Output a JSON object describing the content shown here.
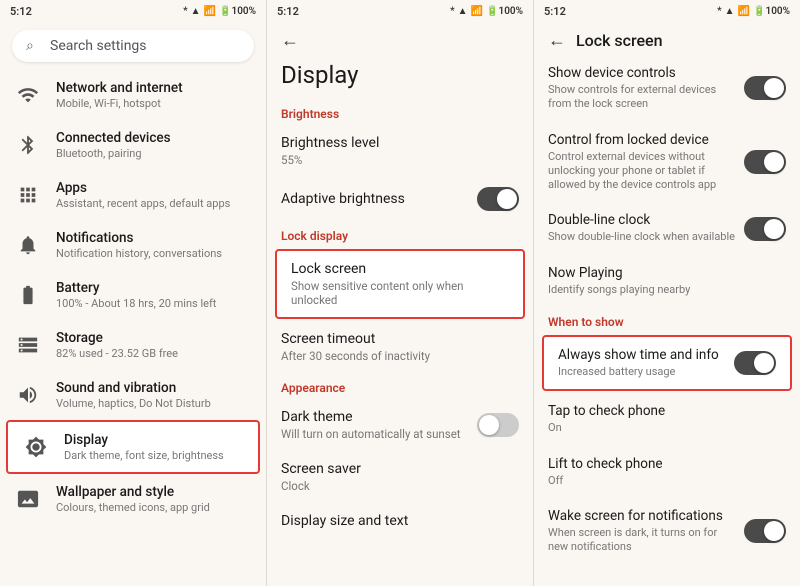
{
  "panels": {
    "panel1": {
      "statusBar": {
        "time": "5:12",
        "icons": "🔵📶📶🔋"
      },
      "search": {
        "placeholder": "Search settings"
      },
      "items": [
        {
          "id": "network",
          "icon": "wifi",
          "title": "Network and internet",
          "subtitle": "Mobile, Wi-Fi, hotspot"
        },
        {
          "id": "connected",
          "icon": "bluetooth",
          "title": "Connected devices",
          "subtitle": "Bluetooth, pairing"
        },
        {
          "id": "apps",
          "icon": "apps",
          "title": "Apps",
          "subtitle": "Assistant, recent apps, default apps"
        },
        {
          "id": "notifications",
          "icon": "bell",
          "title": "Notifications",
          "subtitle": "Notification history, conversations"
        },
        {
          "id": "battery",
          "icon": "battery",
          "title": "Battery",
          "subtitle": "100% - About 18 hrs, 20 mins left"
        },
        {
          "id": "storage",
          "icon": "storage",
          "title": "Storage",
          "subtitle": "82% used - 23.52 GB free"
        },
        {
          "id": "sound",
          "icon": "sound",
          "title": "Sound and vibration",
          "subtitle": "Volume, haptics, Do Not Disturb"
        },
        {
          "id": "display",
          "icon": "display",
          "title": "Display",
          "subtitle": "Dark theme, font size, brightness",
          "highlighted": true
        },
        {
          "id": "wallpaper",
          "icon": "wallpaper",
          "title": "Wallpaper and style",
          "subtitle": "Colours, themed icons, app grid"
        }
      ]
    },
    "panel2": {
      "statusBar": {
        "time": "5:12"
      },
      "title": "Display",
      "sections": [
        {
          "label": "Brightness",
          "items": [
            {
              "id": "brightness-level",
              "title": "Brightness level",
              "subtitle": "55%",
              "hasToggle": false
            },
            {
              "id": "adaptive-brightness",
              "title": "Adaptive brightness",
              "subtitle": "",
              "hasToggle": true,
              "toggleOn": true
            }
          ]
        },
        {
          "label": "Lock display",
          "items": [
            {
              "id": "lock-screen",
              "title": "Lock screen",
              "subtitle": "Show sensitive content only when unlocked",
              "hasToggle": false,
              "highlighted": true
            }
          ]
        },
        {
          "label": "",
          "items": [
            {
              "id": "screen-timeout",
              "title": "Screen timeout",
              "subtitle": "After 30 seconds of inactivity",
              "hasToggle": false
            }
          ]
        },
        {
          "label": "Appearance",
          "items": [
            {
              "id": "dark-theme",
              "title": "Dark theme",
              "subtitle": "Will turn on automatically at sunset",
              "hasToggle": true,
              "toggleOn": false
            },
            {
              "id": "screen-saver",
              "title": "Screen saver",
              "subtitle": "Clock",
              "hasToggle": false
            },
            {
              "id": "display-size",
              "title": "Display size and text",
              "subtitle": "",
              "hasToggle": false
            }
          ]
        }
      ]
    },
    "panel3": {
      "statusBar": {
        "time": "5:12"
      },
      "title": "Lock screen",
      "items": [
        {
          "id": "show-device-controls",
          "title": "Show device controls",
          "subtitle": "Show controls for external devices from the lock screen",
          "hasToggle": true,
          "toggleOn": true
        },
        {
          "id": "control-locked",
          "title": "Control from locked device",
          "subtitle": "Control external devices without unlocking your phone or tablet if allowed by the device controls app",
          "hasToggle": true,
          "toggleOn": true
        },
        {
          "id": "double-line-clock",
          "title": "Double-line clock",
          "subtitle": "Show double-line clock when available",
          "hasToggle": true,
          "toggleOn": true
        },
        {
          "id": "now-playing",
          "title": "Now Playing",
          "subtitle": "Identify songs playing nearby",
          "hasToggle": false
        },
        {
          "id": "when-to-show-label",
          "isLabel": true,
          "label": "When to show"
        },
        {
          "id": "always-show-time",
          "title": "Always show time and info",
          "subtitle": "Increased battery usage",
          "hasToggle": true,
          "toggleOn": true,
          "highlighted": true
        },
        {
          "id": "tap-to-check",
          "title": "Tap to check phone",
          "subtitle": "On",
          "hasToggle": false
        },
        {
          "id": "lift-to-check",
          "title": "Lift to check phone",
          "subtitle": "Off",
          "hasToggle": false
        },
        {
          "id": "wake-screen",
          "title": "Wake screen for notifications",
          "subtitle": "When screen is dark, it turns on for new notifications",
          "hasToggle": true,
          "toggleOn": true
        }
      ]
    }
  },
  "icons": {
    "wifi": "⚬",
    "bluetooth": "⊞",
    "apps": "⋮⋮",
    "bell": "🔔",
    "battery": "▭",
    "storage": "▤",
    "sound": "◎",
    "display": "⊙",
    "wallpaper": "◫",
    "back": "←",
    "search": "⌕"
  }
}
